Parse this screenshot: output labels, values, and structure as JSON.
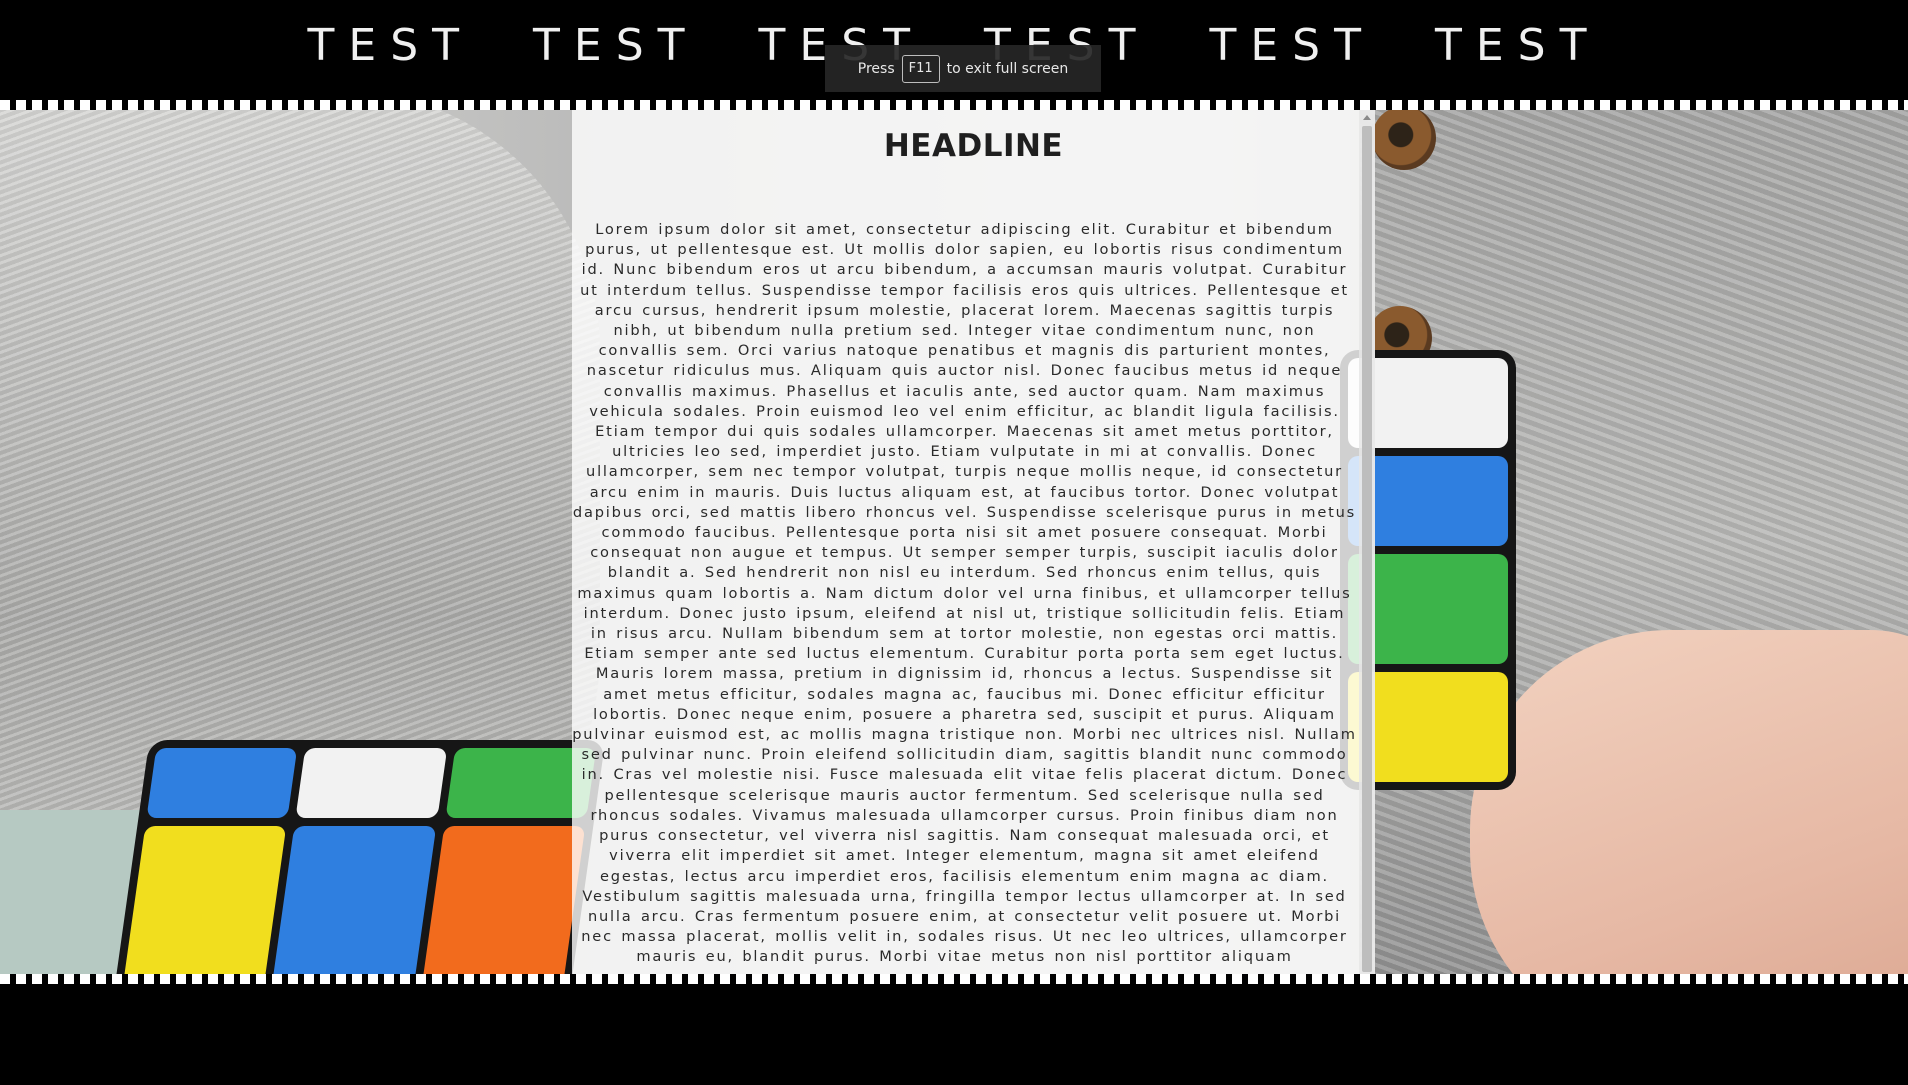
{
  "nav": {
    "items": [
      "TEST",
      "TEST",
      "TEST",
      "TEST",
      "TEST",
      "TEST"
    ]
  },
  "fullscreen_notice": {
    "prefix": "Press",
    "key": "F11",
    "suffix": "to exit full screen"
  },
  "article": {
    "headline": "HEADLINE",
    "body": "Lorem ipsum dolor sit amet, consectetur adipiscing elit. Curabitur et bibendum purus, ut pellentesque est. Ut mollis dolor sapien, eu lobortis risus condimentum id. Nunc bibendum eros ut arcu bibendum, a accumsan mauris volutpat. Curabitur ut interdum tellus. Suspendisse tempor facilisis eros quis ultrices. Pellentesque et arcu cursus, hendrerit ipsum molestie, placerat lorem. Maecenas sagittis turpis nibh, ut bibendum nulla pretium sed. Integer vitae condimentum nunc, non convallis sem. Orci varius natoque penatibus et magnis dis parturient montes, nascetur ridiculus mus. Aliquam quis auctor nisl. Donec faucibus metus id neque convallis maximus. Phasellus et iaculis ante, sed auctor quam. Nam maximus vehicula sodales. Proin euismod leo vel enim efficitur, ac blandit ligula facilisis. Etiam tempor dui quis sodales ullamcorper. Maecenas sit amet metus porttitor, ultricies leo sed, imperdiet justo. Etiam vulputate in mi at convallis. Donec ullamcorper, sem nec tempor volutpat, turpis neque mollis neque, id consectetur arcu enim in mauris. Duis luctus aliquam est, at faucibus tortor. Donec volutpat dapibus orci, sed mattis libero rhoncus vel. Suspendisse scelerisque purus in metus commodo faucibus. Pellentesque porta nisi sit amet posuere consequat. Morbi consequat non augue et tempus. Ut semper semper turpis, suscipit iaculis dolor blandit a. Sed hendrerit non nisl eu interdum. Sed rhoncus enim tellus, quis maximus quam lobortis a. Nam dictum dolor vel urna finibus, et ullamcorper tellus interdum. Donec justo ipsum, eleifend at nisl ut, tristique sollicitudin felis. Etiam in risus arcu. Nullam bibendum sem at tortor molestie, non egestas orci mattis. Etiam semper ante sed luctus elementum. Curabitur porta porta sem eget luctus. Mauris lorem massa, pretium in dignissim id, rhoncus a lectus. Suspendisse sit amet metus efficitur, sodales magna ac, faucibus mi. Donec efficitur efficitur lobortis. Donec neque enim, posuere a pharetra sed, suscipit et purus. Aliquam pulvinar euismod est, ac mollis magna tristique non. Morbi nec ultrices nisl. Nullam sed pulvinar nunc. Proin eleifend sollicitudin diam, sagittis blandit nunc commodo in. Cras vel molestie nisi. Fusce malesuada elit vitae felis placerat dictum. Donec pellentesque scelerisque mauris auctor fermentum. Sed scelerisque nulla sed rhoncus sodales. Vivamus malesuada ullamcorper cursus. Proin finibus diam non purus consectetur, vel viverra nisl sagittis. Nam consequat malesuada orci, et viverra elit imperdiet sit amet. Integer elementum, magna sit amet eleifend egestas, lectus arcu imperdiet eros, facilisis elementum enim magna ac diam. Vestibulum sagittis malesuada urna, fringilla tempor lectus ullamcorper at. In sed nulla arcu. Cras fermentum posuere enim, at consectetur velit posuere ut. Morbi nec massa placerat, mollis velit in, sodales risus. Ut nec leo ultrices, ullamcorper mauris eu, blandit purus. Morbi vitae metus non nisl porttitor aliquam"
  },
  "colors": {
    "background": "#000000",
    "nav_text": "#f0f0f0",
    "panel_overlay": "rgba(255,255,255,0.80)",
    "cube_white": "#f2f2f2",
    "cube_blue": "#2f7fe0",
    "cube_green": "#3cb44a",
    "cube_yellow": "#f1de1e",
    "cube_orange": "#f26b1d"
  },
  "icons": {
    "scroll_up": "triangle-up-icon"
  }
}
